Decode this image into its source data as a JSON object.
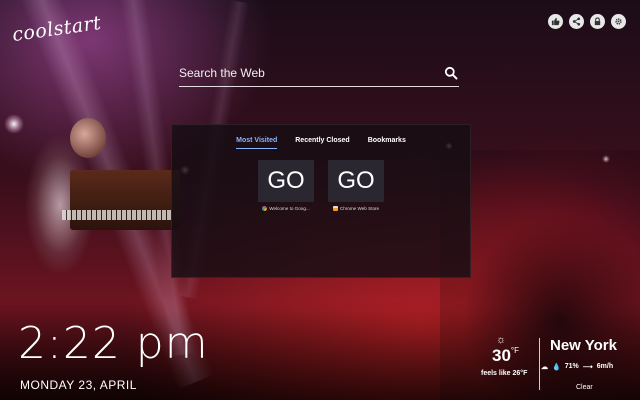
{
  "logo": "coolstart",
  "top_icons": [
    "thumbs-up-icon",
    "share-icon",
    "lock-icon",
    "gear-icon"
  ],
  "search": {
    "placeholder": "Search the Web"
  },
  "tabs": [
    {
      "label": "Most Visited",
      "active": true
    },
    {
      "label": "Recently Closed",
      "active": false
    },
    {
      "label": "Bookmarks",
      "active": false
    }
  ],
  "tiles": [
    {
      "thumb": "GO",
      "caption": "Welcome to Goog...",
      "favicon_color": "#e8e8e8"
    },
    {
      "thumb": "GO",
      "caption": "Chrome Web Store",
      "favicon_color": "#e8e8e8"
    }
  ],
  "clock": {
    "time": "2:22 pm",
    "date": "MONDAY 23, APRIL"
  },
  "weather": {
    "temp": "30",
    "unit": "°F",
    "feels_like": "feels like 26°F",
    "city": "New York",
    "humidity": "71%",
    "wind": "6m/h",
    "condition": "Clear"
  },
  "colors": {
    "accent": "#8ab4ff",
    "panel": "#160e14"
  }
}
